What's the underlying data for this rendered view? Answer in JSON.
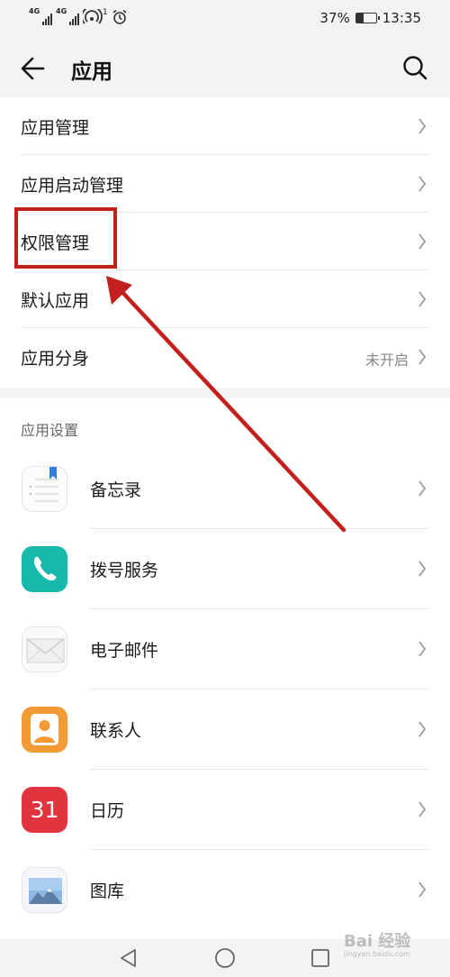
{
  "status_bar": {
    "net1": "4G",
    "net2": "4G",
    "hotspot_count": "1",
    "battery_text": "37%",
    "battery_level": 0.37,
    "time": "13:35"
  },
  "app_bar": {
    "title": "应用"
  },
  "menu": {
    "items": [
      {
        "label": "应用管理"
      },
      {
        "label": "应用启动管理"
      },
      {
        "label": "权限管理"
      },
      {
        "label": "默认应用"
      },
      {
        "label": "应用分身",
        "value": "未开启"
      }
    ]
  },
  "app_settings": {
    "header": "应用设置",
    "apps": [
      {
        "name": "备忘录",
        "icon": "notepad-icon"
      },
      {
        "name": "拨号服务",
        "icon": "phone-icon"
      },
      {
        "name": "电子邮件",
        "icon": "envelope-icon"
      },
      {
        "name": "联系人",
        "icon": "contact-icon"
      },
      {
        "name": "日历",
        "icon": "calendar-icon",
        "icon_text": "31"
      },
      {
        "name": "图库",
        "icon": "gallery-icon"
      }
    ]
  },
  "watermark": {
    "main": "Bai 经验",
    "sub": "jingyan.baidu.com"
  },
  "colors": {
    "highlight": "#c3201d",
    "phone_icon": "#18b9ad",
    "contact_icon": "#f29a33",
    "calendar_icon": "#e0343e"
  }
}
